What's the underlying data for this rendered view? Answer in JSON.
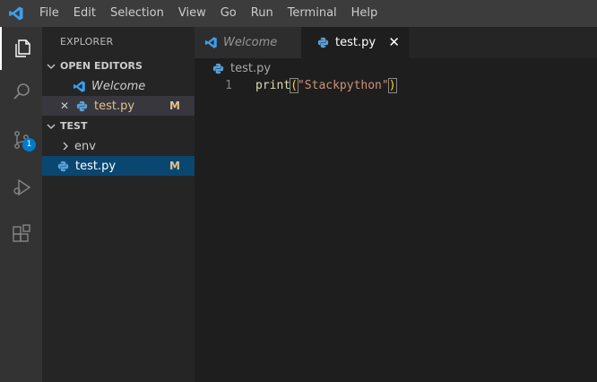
{
  "menubar": {
    "items": [
      "File",
      "Edit",
      "Selection",
      "View",
      "Go",
      "Run",
      "Terminal",
      "Help"
    ]
  },
  "activitybar": {
    "icons": [
      "explorer-icon",
      "search-icon",
      "source-control-icon",
      "run-debug-icon",
      "extensions-icon"
    ],
    "scm_badge": "1"
  },
  "sidebar": {
    "title": "EXPLORER",
    "open_editors": {
      "heading": "OPEN EDITORS",
      "items": [
        {
          "label": "Welcome",
          "icon": "vscode-icon"
        },
        {
          "label": "test.py",
          "icon": "python-icon",
          "status": "M",
          "close": "✕"
        }
      ]
    },
    "workspace": {
      "heading": "TEST",
      "items": [
        {
          "label": "env",
          "type": "folder"
        },
        {
          "label": "test.py",
          "icon": "python-icon",
          "status": "M"
        }
      ]
    }
  },
  "editor": {
    "tabs": [
      {
        "label": "Welcome",
        "icon": "vscode-icon"
      },
      {
        "label": "test.py",
        "icon": "python-icon",
        "close": "✕"
      }
    ],
    "breadcrumb": "test.py",
    "lines": [
      {
        "number": "1",
        "func": "print",
        "open": "(",
        "string": "\"Stackpython\"",
        "close": ")"
      }
    ]
  },
  "colors": {
    "accent": "#007acc",
    "modified": "#e2c08d",
    "selection": "#094771"
  }
}
